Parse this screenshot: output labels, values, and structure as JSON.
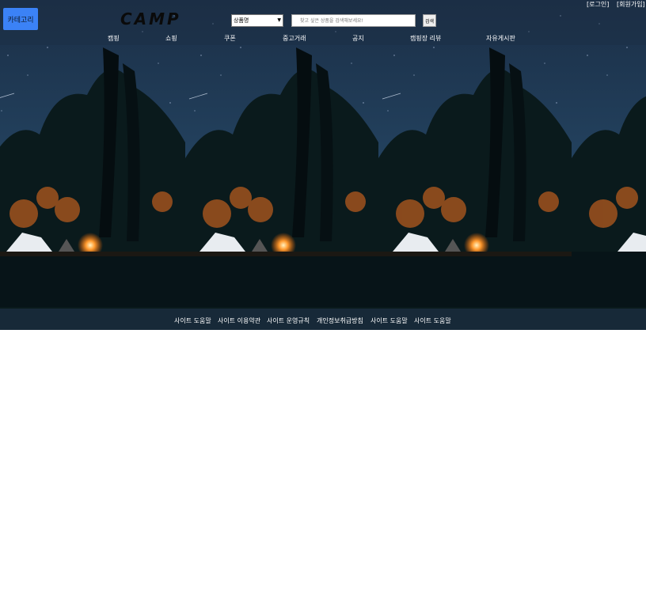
{
  "header": {
    "category_label": "카테고리",
    "logo_text": "CAMP",
    "search": {
      "selected_option": "상품명",
      "placeholder": "찾고 싶은 상품을 검색해보세요!",
      "button_label": "검색"
    },
    "auth": {
      "login": "[로그인]",
      "signup": "[회원가입]"
    }
  },
  "nav": {
    "items": [
      {
        "label": "캠핑"
      },
      {
        "label": "쇼핑"
      },
      {
        "label": "쿠폰"
      },
      {
        "label": "중고거래"
      },
      {
        "label": "공지"
      },
      {
        "label": "캠핑장 리뷰"
      },
      {
        "label": "자유게시판"
      }
    ]
  },
  "footer": {
    "links": [
      {
        "label": "사이트 도움말"
      },
      {
        "label": "사이트 이용약관"
      },
      {
        "label": "사이트 운영규칙"
      },
      {
        "label": "개인정보취급방침"
      },
      {
        "label": "사이트 도움말"
      },
      {
        "label": "사이트 도움말"
      }
    ]
  },
  "colors": {
    "accent": "#3b82f6",
    "night_sky": "#1e3a5c",
    "campfire": "#ff7a1a"
  }
}
